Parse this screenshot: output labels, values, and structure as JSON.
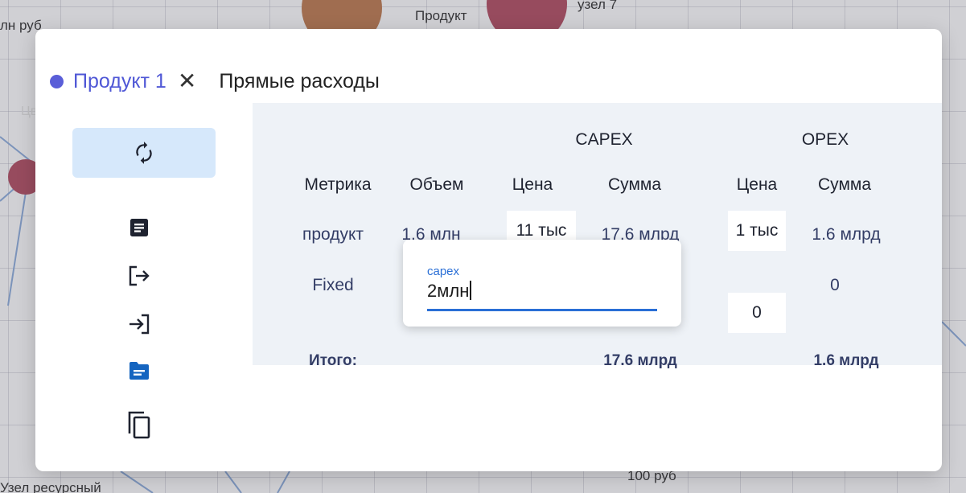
{
  "background": {
    "texts": [
      "лн руб",
      "Продукт",
      "узел 7",
      "Цвет узла",
      "100 руб",
      "Узел ресурсный"
    ]
  },
  "modal": {
    "node_color": "#5a5ed8",
    "title": "Продукт 1",
    "close_icon": "close-icon",
    "subtitle": "Прямые расходы",
    "sidebar_icons": [
      "refresh-icon",
      "document-icon",
      "export-icon",
      "import-icon",
      "folder-icon",
      "copy-icon"
    ]
  },
  "table": {
    "group_headers": {
      "capex": "CAPEX",
      "opex": "OPEX"
    },
    "columns": [
      "Метрика",
      "Объем",
      "Цена",
      "Сумма",
      "Цена",
      "Сумма"
    ],
    "rows": [
      {
        "metric": "продукт",
        "volume": "1.6 млн",
        "capex_price": "11 тыс",
        "capex_sum": "17.6 млрд",
        "opex_price": "1 тыс",
        "opex_sum": "1.6 млрд"
      },
      {
        "metric": "Fixed",
        "opex_price": "0",
        "opex_sum": "0"
      }
    ],
    "total": {
      "label": "Итого:",
      "capex_sum": "17.6 млрд",
      "opex_sum": "1.6 млрд"
    }
  },
  "editor": {
    "label": "capex",
    "value": "2млн"
  }
}
